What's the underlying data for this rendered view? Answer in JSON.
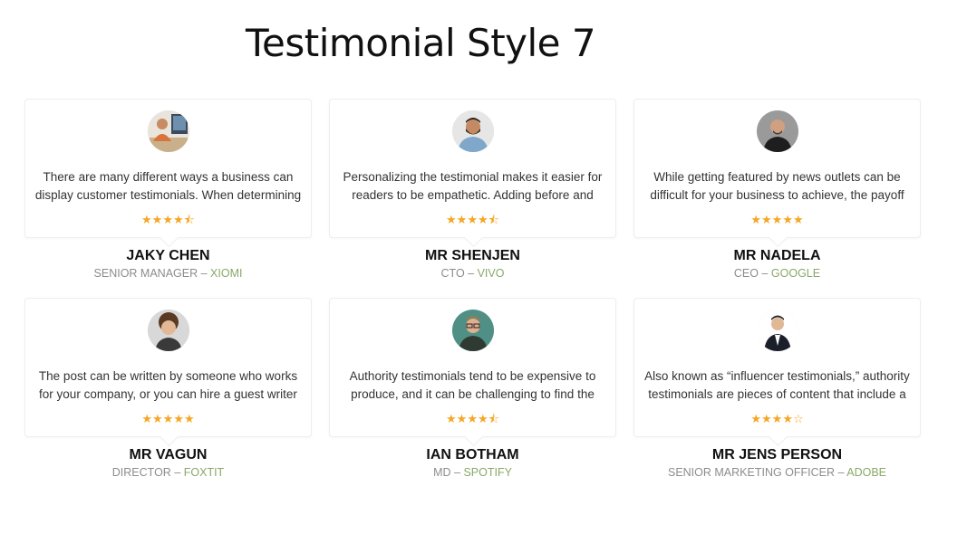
{
  "page": {
    "title": "Testimonial Style 7"
  },
  "colors": {
    "star": "#f5a623",
    "company": "#8aa86a",
    "role": "#8c8c8c"
  },
  "testimonials": [
    {
      "name": "JAKY CHEN",
      "position": "SENIOR MANAGER",
      "separator": " – ",
      "company": "XIOMI",
      "quote": "There are many different ways a business can display customer testimonials. When determining the bes",
      "rating": 4.5,
      "stars": "★★★★⯪",
      "avatar": "avatar-photo-office"
    },
    {
      "name": "MR SHENJEN",
      "position": "CTO",
      "separator": " – ",
      "company": "VIVO",
      "quote": "Personalizing the testimonial makes it easier for readers to be empathetic. Adding before and after",
      "rating": 4.5,
      "stars": "★★★★⯪",
      "avatar": "avatar-photo-beard-man"
    },
    {
      "name": "MR NADELA",
      "position": "CEO",
      "separator": " – ",
      "company": "GOOGLE",
      "quote": "While getting featured by news outlets can be difficult for your business to achieve, the payoff can",
      "rating": 5,
      "stars": "★★★★★",
      "avatar": "avatar-photo-bald-man"
    },
    {
      "name": "MR VAGUN",
      "position": "DIRECTOR",
      "separator": " – ",
      "company": "FOXTIT",
      "quote": "The post can be written by someone who works for your company, or you can hire a guest writer to com",
      "rating": 5,
      "stars": "★★★★★",
      "avatar": "avatar-photo-curly-hair"
    },
    {
      "name": "IAN BOTHAM",
      "position": "MD",
      "separator": " – ",
      "company": "SPOTIFY",
      "quote": "Authority testimonials tend to be expensive to produce, and it can be challenging to find the right",
      "rating": 4.5,
      "stars": "★★★★⯪",
      "avatar": "avatar-photo-glasses-man"
    },
    {
      "name": "MR JENS PERSON",
      "position": "SENIOR MARKETING OFFICER",
      "separator": " – ",
      "company": "ADOBE",
      "quote": "Also known as “influencer testimonials,” authority testimonials are pieces of content that include a",
      "rating": 4,
      "stars": "★★★★☆",
      "avatar": "avatar-photo-suit-man"
    }
  ]
}
